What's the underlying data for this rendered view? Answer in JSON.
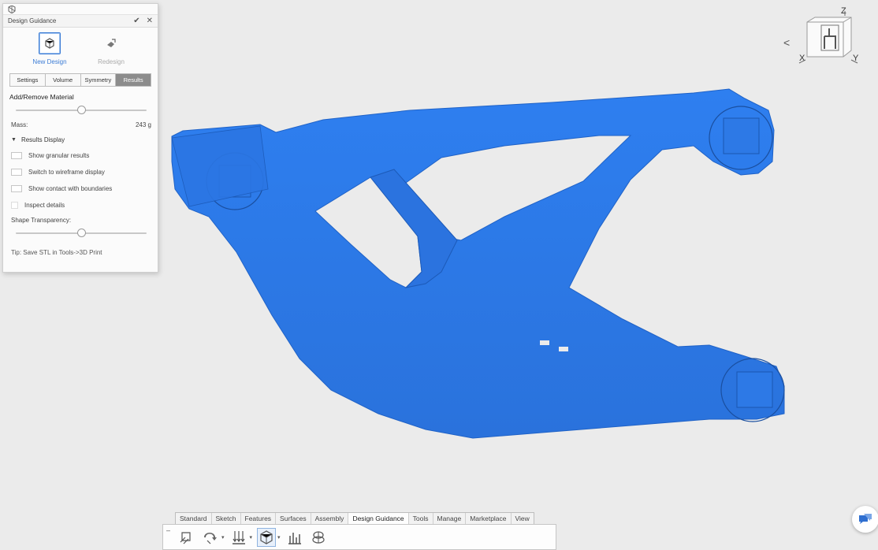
{
  "panel": {
    "title": "Design Guidance",
    "confirm_icon": "check-icon",
    "close_icon": "close-icon",
    "modes": [
      {
        "label": "New Design",
        "icon": "new-design-icon",
        "active": true
      },
      {
        "label": "Redesign",
        "icon": "redesign-icon",
        "active": false
      }
    ],
    "tabs": [
      "Settings",
      "Volume",
      "Symmetry",
      "Results"
    ],
    "active_tab": "Results",
    "add_remove_label": "Add/Remove Material",
    "add_remove_value_fraction": 0.5,
    "mass_label": "Mass:",
    "mass_value": "243 g",
    "results_display_label": "Results Display",
    "checkboxes": [
      {
        "label": "Show granular results",
        "checked": false
      },
      {
        "label": "Switch to wireframe display",
        "checked": false
      },
      {
        "label": "Show contact with boundaries",
        "checked": false
      },
      {
        "label": "Inspect details",
        "checked": false
      }
    ],
    "shape_transparency_label": "Shape Transparency:",
    "shape_transparency_fraction": 0.5,
    "tip": "Tip: Save STL in Tools->3D Print"
  },
  "viewcube": {
    "z": "Z",
    "x": "X",
    "y": "Y",
    "back": "<"
  },
  "ribbon": {
    "tabs": [
      "Standard",
      "Sketch",
      "Features",
      "Surfaces",
      "Assembly",
      "Design Guidance",
      "Tools",
      "Manage",
      "Marketplace",
      "View"
    ],
    "active_tab": "Design Guidance",
    "collapse": "–",
    "tool_icons": [
      "boundary-conditions-icon",
      "loads-icon",
      "load-case-icon",
      "design-space-icon",
      "results-chart-icon",
      "mesh-settings-icon"
    ]
  },
  "colors": {
    "part": "#2f7fe8",
    "accent": "#3a7bd5",
    "background": "#ebebeb"
  }
}
